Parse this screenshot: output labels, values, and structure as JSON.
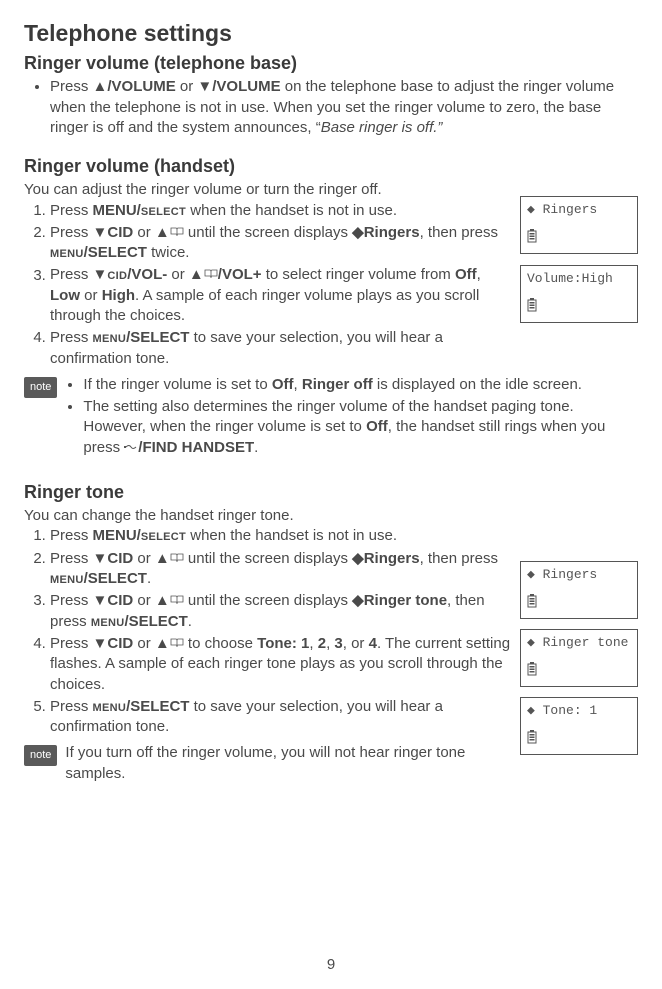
{
  "title": "Telephone settings",
  "section1": {
    "heading": "Ringer volume (telephone base)",
    "bullet1": {
      "pre": "Press ",
      "b1": "▲/VOLUME",
      "mid": " or ",
      "b2": "▼/VOLUME",
      "post1": " on the telephone base to adjust the ringer volume when the telephone is not in use. When you set the ringer volume to zero, the base ringer is off and the system announces, “",
      "italic": "Base ringer is off.”"
    }
  },
  "section2": {
    "heading": "Ringer volume (handset)",
    "intro": "You can adjust the ringer volume or turn the ringer off.",
    "step1": {
      "pre": "Press ",
      "b1": "MENU/",
      "sc1": "select",
      "post": " when the handset is not in use."
    },
    "step2": {
      "pre": "Press ",
      "b1": "▼CID",
      "mid1": " or ",
      "b2": "▲",
      "mid2": " until the screen displays ",
      "b3": "◆Ringers",
      "mid3": ", then press ",
      "sc2": "menu",
      "b4": "/SELECT",
      "post": " twice."
    },
    "step3": {
      "pre": "Press ",
      "b1": "▼",
      "sc1": "cid",
      "b2": "/VOL-",
      "mid1": " or ",
      "b3": "▲",
      "b4": "/VOL+",
      "mid2": " to select ringer volume from ",
      "b5": "Off",
      "mid3": ", ",
      "b6": "Low",
      "mid4": " or ",
      "b7": "High",
      "post": ". A sample of each ringer volume plays as you scroll through the choices."
    },
    "step4": {
      "pre": "Press ",
      "sc1": "menu",
      "b1": "/SELECT",
      "post": " to save your selection, you will hear a confirmation tone."
    },
    "note": {
      "label": "note",
      "b1": {
        "pre": "If the ringer volume is set to ",
        "b": "Off",
        "mid": ", ",
        "b2": "Ringer off",
        "post": " is displayed on the idle screen."
      },
      "b2": {
        "pre": "The setting also determines the ringer volume of the handset paging tone. However, when the ringer volume is set to ",
        "b": "Off",
        "mid": ", the handset still rings when you press ",
        "b2": "/FIND HANDSET",
        "post": "."
      }
    },
    "lcd1": {
      "line1": "◆ Ringers"
    },
    "lcd2": {
      "line1": "Volume:High"
    }
  },
  "section3": {
    "heading": "Ringer tone",
    "intro": "You can change the handset ringer tone.",
    "step1": {
      "pre": "Press ",
      "b1": "MENU/",
      "sc1": "select",
      "post": " when the handset is not in use."
    },
    "step2": {
      "pre": "Press ",
      "b1": "▼CID",
      "mid1": " or ",
      "b2": "▲",
      "mid2": " until the screen displays ",
      "b3": "◆Ringers",
      "mid3": ", then press ",
      "sc2": "menu",
      "b4": "/SELECT",
      "post": "."
    },
    "step3": {
      "pre": "Press ",
      "b1": "▼CID",
      "mid1": " or ",
      "b2": "▲",
      "mid2": " until the screen displays ",
      "b3": "◆Ringer tone",
      "mid3": ", then press ",
      "sc2": "menu",
      "b4": "/SELECT",
      "post": "."
    },
    "step4": {
      "pre": "Press ",
      "b1": "▼CID",
      "mid1": " or ",
      "b2": "▲",
      "mid2": " to choose ",
      "b3": "Tone: 1",
      "mid3": ", ",
      "b4": "2",
      "mid4": ", ",
      "b5": "3",
      "mid5": ", or ",
      "b6": "4",
      "post": ". The current setting flashes. A sample of each ringer tone plays as you scroll through the choices."
    },
    "step5": {
      "pre": "Press ",
      "sc1": "menu",
      "b1": "/SELECT",
      "post": " to save your selection, you will hear a confirmation tone."
    },
    "note": {
      "label": "note",
      "text": "If you turn off the ringer volume, you will not hear ringer tone samples."
    },
    "lcd1": {
      "line1": "◆ Ringers"
    },
    "lcd2": {
      "line1": "◆ Ringer tone"
    },
    "lcd3": {
      "line1": "◆ Tone: 1"
    }
  },
  "page_number": "9"
}
